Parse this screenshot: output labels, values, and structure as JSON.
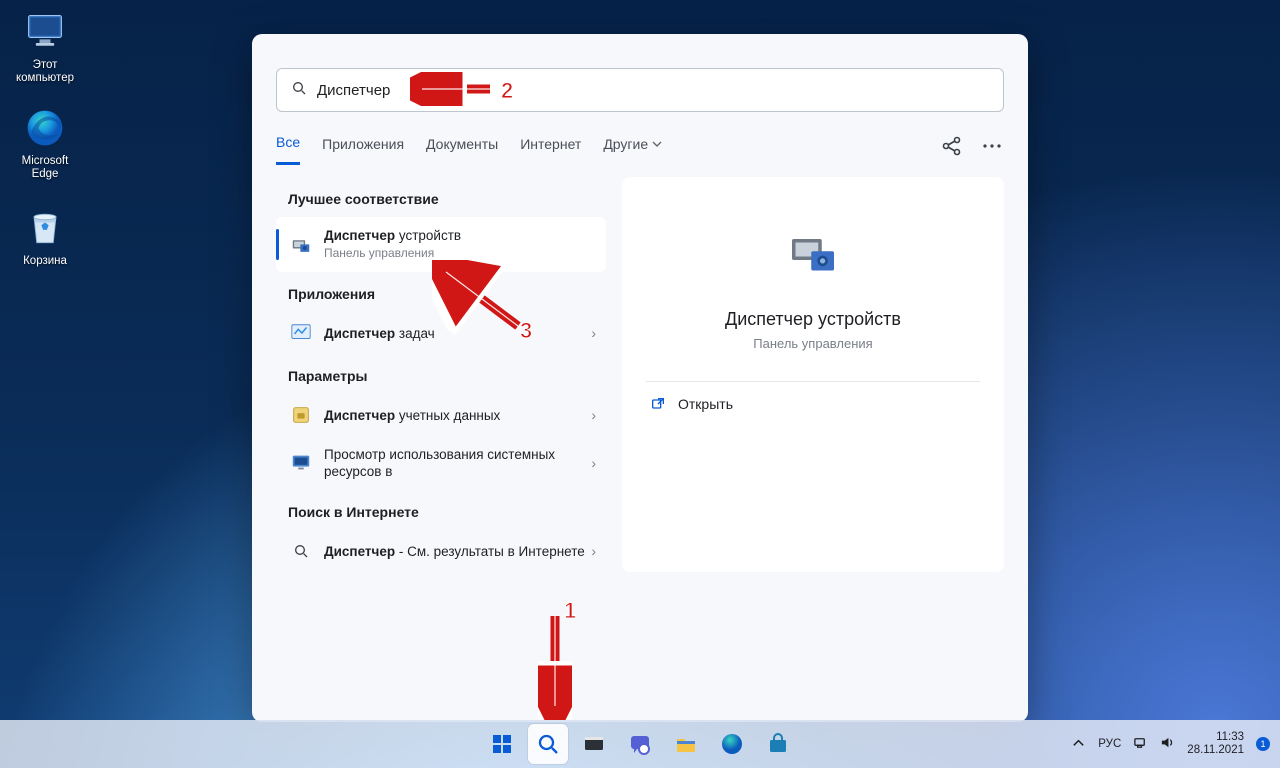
{
  "desktop": {
    "icons": [
      {
        "name": "this-pc",
        "label": "Этот\nкомпьютер"
      },
      {
        "name": "edge",
        "label": "Microsoft\nEdge"
      },
      {
        "name": "recycle-bin",
        "label": "Корзина"
      }
    ]
  },
  "search": {
    "value": "Диспетчер",
    "tabs": [
      "Все",
      "Приложения",
      "Документы",
      "Интернет",
      "Другие"
    ],
    "tabs_active_index": 0,
    "section_best": "Лучшее соответствие",
    "best": {
      "title_bold": "Диспетчер",
      "title_rest": " устройств",
      "sub": "Панель управления"
    },
    "section_apps": "Приложения",
    "apps": [
      {
        "title_bold": "Диспетчер",
        "title_rest": " задач"
      }
    ],
    "section_settings": "Параметры",
    "settings": [
      {
        "title_bold": "Диспетчер",
        "title_rest": " учетных данных"
      },
      {
        "title_bold": "",
        "title_rest": "Просмотр использования системных ресурсов в"
      }
    ],
    "section_web": "Поиск в Интернете",
    "web": [
      {
        "title_bold": "Диспетчер",
        "title_rest": " - См. результаты в Интернете"
      }
    ],
    "preview": {
      "title": "Диспетчер устройств",
      "sub": "Панель управления",
      "open": "Открыть"
    }
  },
  "taskbar": {
    "lang": "РУС",
    "time": "11:33",
    "date": "28.11.2021",
    "notif_count": "1"
  },
  "annotations": {
    "a1": "1",
    "a2": "2",
    "a3": "3"
  }
}
